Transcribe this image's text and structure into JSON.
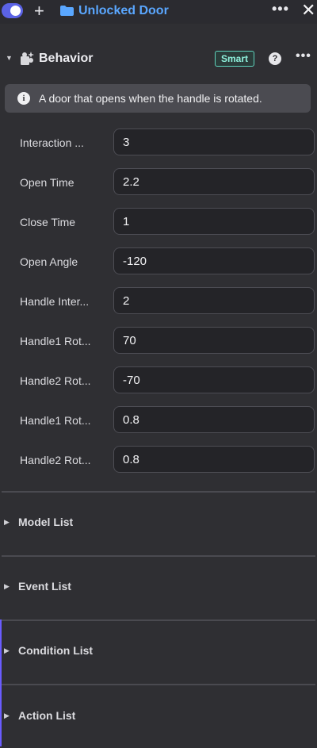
{
  "topbar": {
    "title": "Unlocked Door"
  },
  "behavior": {
    "header": "Behavior",
    "badge": "Smart",
    "help": "?",
    "info": "A door that opens when the handle is rotated.",
    "fields": [
      {
        "label": "Interaction ...",
        "value": "3"
      },
      {
        "label": "Open Time",
        "value": "2.2"
      },
      {
        "label": "Close Time",
        "value": "1"
      },
      {
        "label": "Open Angle",
        "value": "-120"
      },
      {
        "label": "Handle Inter...",
        "value": "2"
      },
      {
        "label": "Handle1 Rot...",
        "value": "70"
      },
      {
        "label": "Handle2 Rot...",
        "value": "-70"
      },
      {
        "label": "Handle1 Rot...",
        "value": "0.8"
      },
      {
        "label": "Handle2 Rot...",
        "value": "0.8"
      }
    ]
  },
  "lists": [
    {
      "label": "Model List"
    },
    {
      "label": "Event List"
    },
    {
      "label": "Condition List"
    },
    {
      "label": "Action List"
    }
  ],
  "colors": {
    "accent": "#5b63e6",
    "title": "#5aa7ff",
    "badge_border": "#5fd3bd"
  }
}
